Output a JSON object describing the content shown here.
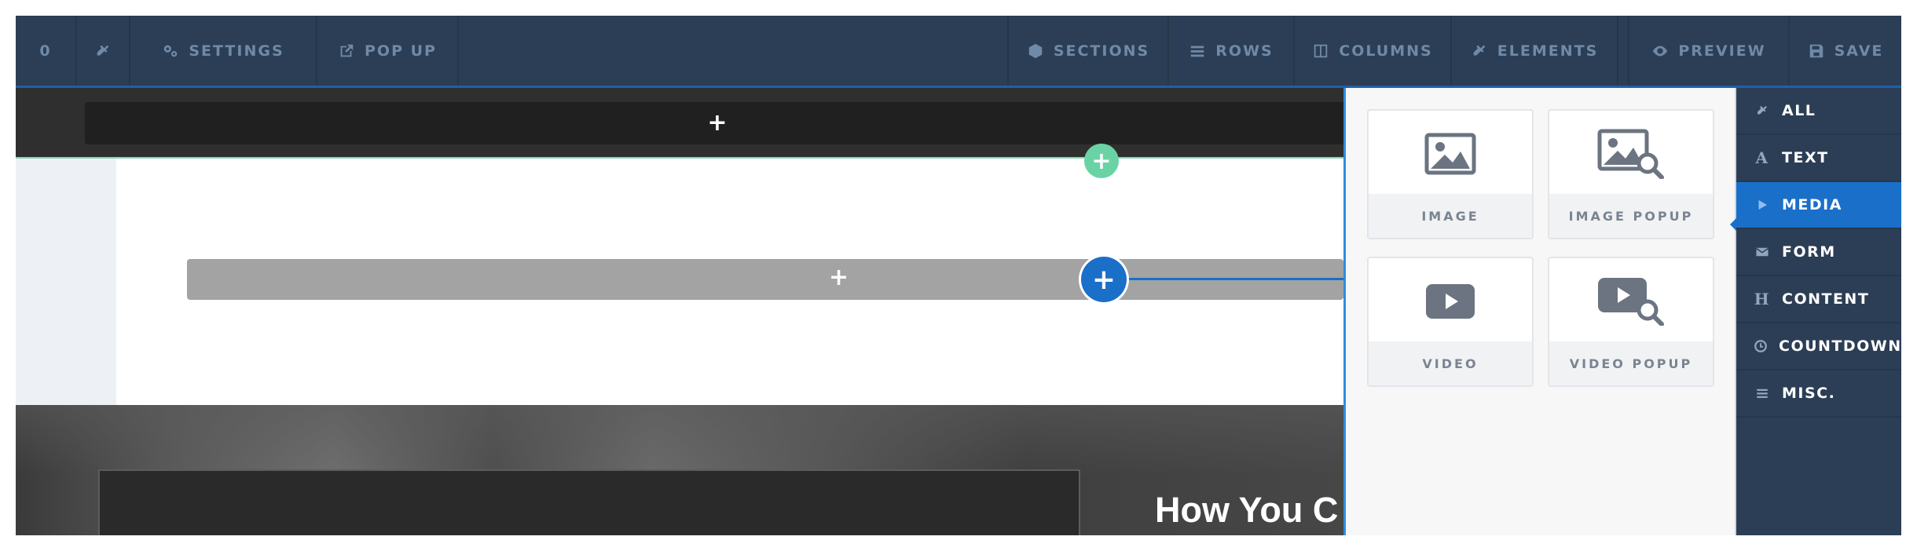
{
  "toolbar": {
    "left_partial_glyph": "0",
    "settings_label": "SETTINGS",
    "popup_label": "POP UP",
    "sections_label": "SECTIONS",
    "rows_label": "ROWS",
    "columns_label": "COLUMNS",
    "elements_label": "ELEMENTS",
    "preview_label": "PREVIEW",
    "save_label": "SAVE"
  },
  "canvas": {
    "add_section_symbol": "+",
    "add_row_symbol": "+",
    "add_column_symbol": "+",
    "add_element_symbol": "+",
    "headline_partial": "How You C"
  },
  "element_panel": {
    "cards": [
      {
        "label": "IMAGE",
        "icon": "image-icon"
      },
      {
        "label": "IMAGE POPUP",
        "icon": "image-popup-icon"
      },
      {
        "label": "VIDEO",
        "icon": "video-icon"
      },
      {
        "label": "VIDEO POPUP",
        "icon": "video-popup-icon"
      }
    ]
  },
  "categories": {
    "items": [
      {
        "label": "ALL",
        "icon": "plug-icon"
      },
      {
        "label": "TEXT",
        "icon": "text-icon",
        "glyph": "A"
      },
      {
        "label": "MEDIA",
        "icon": "play-icon",
        "active": true
      },
      {
        "label": "FORM",
        "icon": "envelope-icon"
      },
      {
        "label": "CONTENT",
        "icon": "heading-icon",
        "glyph": "H"
      },
      {
        "label": "COUNTDOWN",
        "icon": "clock-icon"
      },
      {
        "label": "MISC.",
        "icon": "bars-icon"
      }
    ]
  },
  "colors": {
    "toolbar_bg": "#2c3e55",
    "accent_blue": "#1a6fc9",
    "accent_green": "#6ad3a6"
  }
}
